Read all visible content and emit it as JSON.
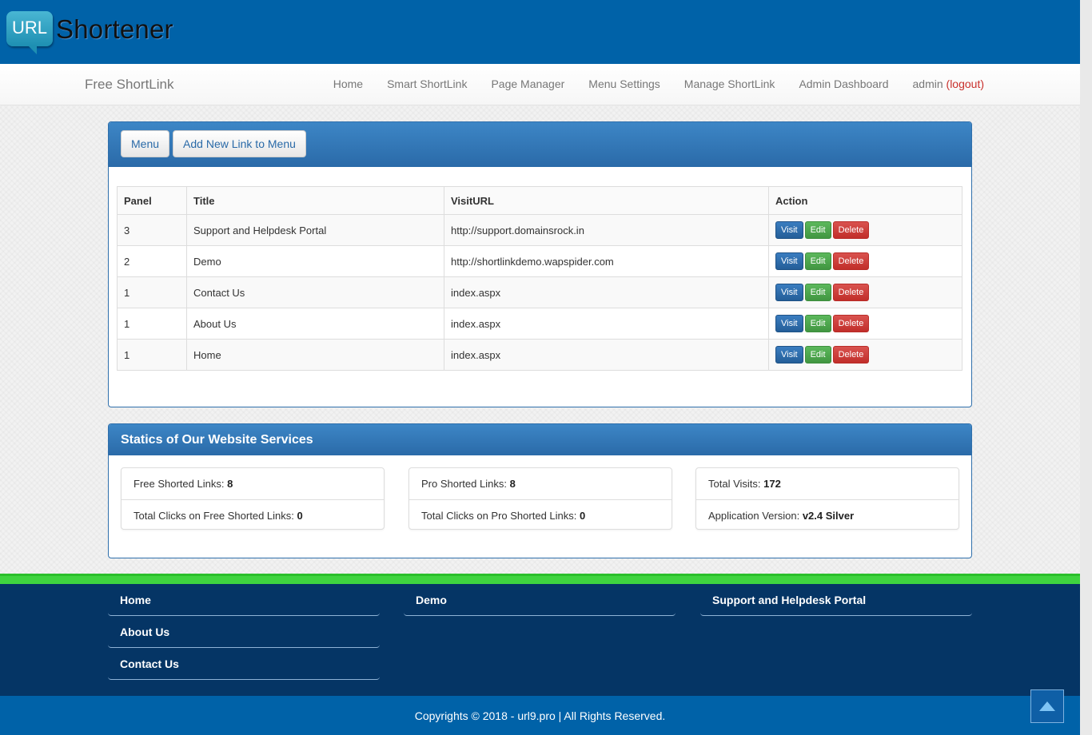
{
  "logo": {
    "url_text": "URL",
    "name": "Shortener"
  },
  "navbar": {
    "brand": "Free ShortLink",
    "items": [
      {
        "label": "Home"
      },
      {
        "label": "Smart ShortLink"
      },
      {
        "label": "Page Manager"
      },
      {
        "label": "Menu Settings"
      },
      {
        "label": "Manage ShortLink"
      },
      {
        "label": "Admin Dashboard"
      }
    ],
    "user": "admin",
    "logout": "(logout)"
  },
  "menu_panel": {
    "buttons": {
      "menu": "Menu",
      "add": "Add New Link to Menu"
    },
    "columns": [
      "Panel",
      "Title",
      "VisitURL",
      "Action"
    ],
    "rows": [
      {
        "panel": "3",
        "title": "Support and Helpdesk Portal",
        "url": "http://support.domainsrock.in"
      },
      {
        "panel": "2",
        "title": "Demo",
        "url": "http://shortlinkdemo.wapspider.com"
      },
      {
        "panel": "1",
        "title": "Contact Us",
        "url": "index.aspx"
      },
      {
        "panel": "1",
        "title": "About Us",
        "url": "index.aspx"
      },
      {
        "panel": "1",
        "title": "Home",
        "url": "index.aspx"
      }
    ],
    "actions": {
      "visit": "Visit",
      "edit": "Edit",
      "delete": "Delete"
    }
  },
  "stats_panel": {
    "title": "Statics of Our Website Services",
    "free_links_label": "Free Shorted Links:",
    "free_links_value": "8",
    "free_clicks_label": "Total Clicks on Free Shorted Links:",
    "free_clicks_value": "0",
    "pro_links_label": "Pro Shorted Links:",
    "pro_links_value": "8",
    "pro_clicks_label": "Total Clicks on Pro Shorted Links:",
    "pro_clicks_value": "0",
    "visits_label": "Total Visits:",
    "visits_value": "172",
    "version_label": "Application Version:",
    "version_value": "v2.4 Silver"
  },
  "footer": {
    "col1": [
      "Home",
      "About Us",
      "Contact Us"
    ],
    "col2": [
      "Demo"
    ],
    "col3": [
      "Support and Helpdesk Portal"
    ],
    "copyright": "Copyrights © 2018 - url9.pro | All Rights Reserved."
  },
  "colors": {
    "header_blue": "#0062a8",
    "panel_head_blue": "#2a6aa8",
    "footer_navy": "#053565",
    "footer_green_line": "#3fd43f",
    "visit_btn": "#245e98",
    "edit_btn": "#419641",
    "delete_btn": "#c12e2a"
  },
  "icons": {
    "scroll_top": "arrow-up-icon"
  }
}
